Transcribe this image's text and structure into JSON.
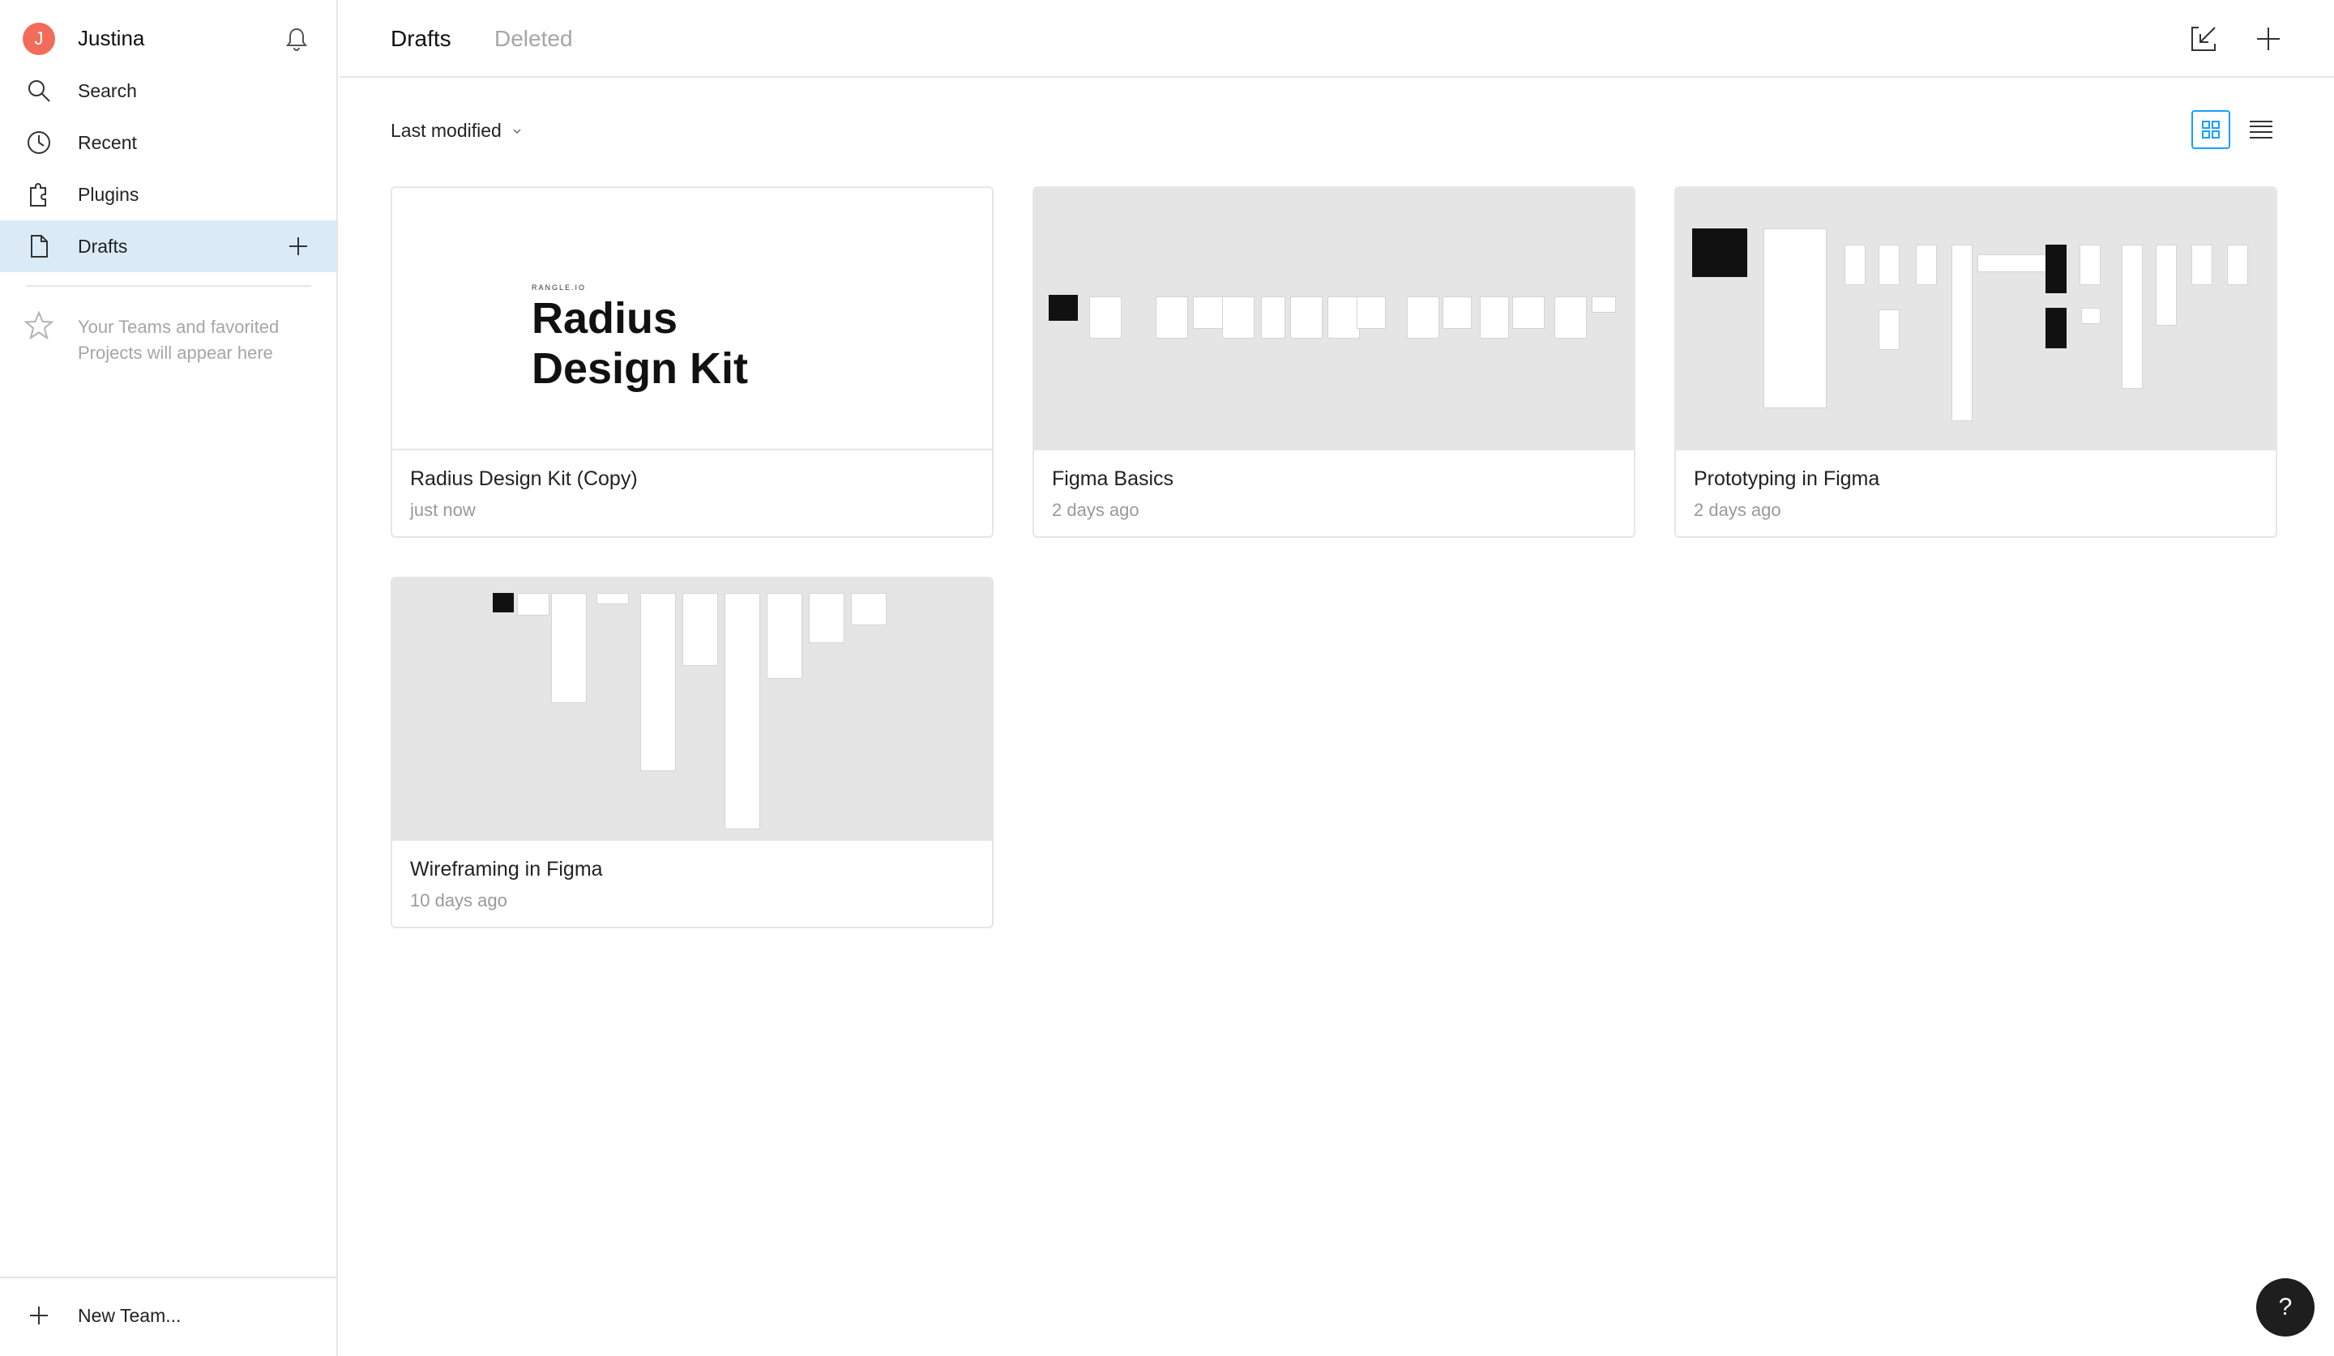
{
  "sidebar": {
    "user": {
      "initial": "J",
      "name": "Justina",
      "avatar_color": "#f26b5b"
    },
    "nav": [
      {
        "label": "Search",
        "icon": "search-icon"
      },
      {
        "label": "Recent",
        "icon": "clock-icon"
      },
      {
        "label": "Plugins",
        "icon": "plugin-icon"
      },
      {
        "label": "Drafts",
        "icon": "file-icon",
        "active": true
      }
    ],
    "favorites_hint": "Your Teams and favorited Projects will appear here",
    "new_team_label": "New Team..."
  },
  "header": {
    "tabs": [
      {
        "label": "Drafts",
        "active": true
      },
      {
        "label": "Deleted",
        "active": false
      }
    ],
    "icons": [
      "import-icon",
      "plus-icon"
    ]
  },
  "toolbar": {
    "sort_label": "Last modified",
    "view_modes": [
      "grid",
      "list"
    ],
    "active_view": "grid"
  },
  "files": [
    {
      "title": "Radius Design Kit (Copy)",
      "modified": "just now",
      "thumb_small": "RANGLE.IO",
      "thumb_title_1": "Radius",
      "thumb_title_2": "Design Kit"
    },
    {
      "title": "Figma Basics",
      "modified": "2 days ago"
    },
    {
      "title": "Prototyping in Figma",
      "modified": "2 days ago"
    },
    {
      "title": "Wireframing in Figma",
      "modified": "10 days ago"
    }
  ],
  "help_label": "?",
  "colors": {
    "accent": "#18a0fb",
    "active_nav_bg": "#daebf7"
  }
}
